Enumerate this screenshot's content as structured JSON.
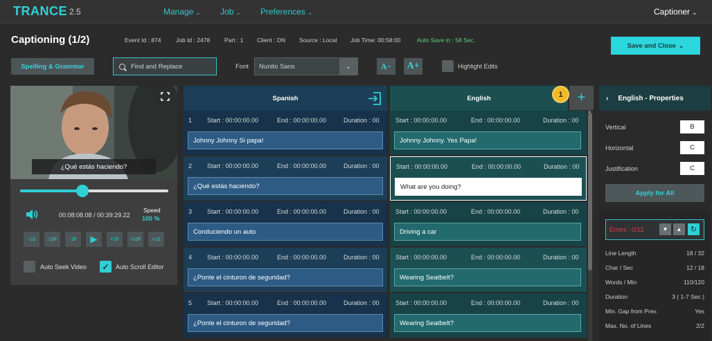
{
  "app": {
    "name": "TRANCE",
    "version": "2.5"
  },
  "nav": [
    {
      "label": "Manage"
    },
    {
      "label": "Job"
    },
    {
      "label": "Preferences"
    }
  ],
  "user": {
    "label": "Captioner"
  },
  "job": {
    "title": "Captioning (1/2)",
    "event_id": "Event Id : 874",
    "job_id": "Job Id : 2478",
    "part": "Part : 1",
    "client": "Client : DN",
    "source": "Source : Local",
    "job_time": "Job Time: 00:58:00",
    "auto_save": "Auto Save in : 58 Sec."
  },
  "toolbar": {
    "save_close": "Save and Close",
    "spelling": "Spelling & Grammar",
    "find_placeholder": "Find and Replace",
    "font_label": "Font",
    "font_value": "Nunito Sans",
    "decrease_font": "A−",
    "increase_font": "A+",
    "highlight_edits": "Highlight Edits"
  },
  "player": {
    "subtitle": "¿Qué estás haciendo?",
    "timecode": "00:08:08.08 / 00:39:29.22",
    "speed_label": "Speed",
    "speed_value": "100 %",
    "progress": 0.42,
    "controls": [
      "-1S",
      "-10F",
      "-1F",
      "▶",
      "+1F",
      "+10F",
      "+1S"
    ],
    "auto_seek": "Auto Seek Video",
    "auto_scroll": "Auto Scroll Editor"
  },
  "columns": {
    "source_title": "Spanish",
    "target_title": "English",
    "badge": "1",
    "add": "+"
  },
  "rows": [
    {
      "num": "1",
      "start": "Start : 00:00:00.00",
      "end": "End : 00:00:00.00",
      "duration": "Duration : 00",
      "source": "Johnny Johnny Si papa!",
      "target": "Johnny Johnny. Yes Papa!"
    },
    {
      "num": "2",
      "start": "Start : 00:00:00.00",
      "end": "End : 00:00:00.00",
      "duration": "Duration : 00",
      "source": "¿Qué estás haciendo?",
      "target": "What are you doing?"
    },
    {
      "num": "3",
      "start": "Start : 00:00:00.00",
      "end": "End : 00:00:00.00",
      "duration": "Duration : 00",
      "source": "Conduciendo un auto",
      "target": "Driving a car"
    },
    {
      "num": "4",
      "start": "Start : 00:00:00.00",
      "end": "End : 00:00:00.00",
      "duration": "Duration : 00",
      "source": "¿Ponte el cinturon de seguridad?",
      "target": "Wearing Seatbelt?"
    },
    {
      "num": "5",
      "start": "Start : 00:00:00.00",
      "end": "End : 00:00:00.00",
      "duration": "Duration : 00",
      "source": "¿Ponte el cinturon de seguridad?",
      "target": "Wearing Seatbelt?"
    }
  ],
  "properties": {
    "title": "English - Properties",
    "vertical_label": "Vertical",
    "vertical_value": "B",
    "horizontal_label": "Horizontal",
    "horizontal_value": "C",
    "justification_label": "Justification",
    "justification_value": "C",
    "apply": "Apply for All",
    "errors": "Errors : 0/12",
    "stats": [
      {
        "label": "Line Length",
        "value": "18 / 32"
      },
      {
        "label": "Char / Sec",
        "value": "12 / 18"
      },
      {
        "label": "Words / Min",
        "value": "110/120"
      },
      {
        "label": "Duration",
        "value": "3 ( 1-7 Sec )"
      },
      {
        "label": "Min. Gap from Prev.",
        "value": "Yes"
      },
      {
        "label": "Max. No. of Lines",
        "value": "2/2"
      }
    ]
  },
  "colors": {
    "accent": "#2fd0d5",
    "source_col": "#1c3e57",
    "target_col": "#1c4f52",
    "error": "#e04040"
  }
}
